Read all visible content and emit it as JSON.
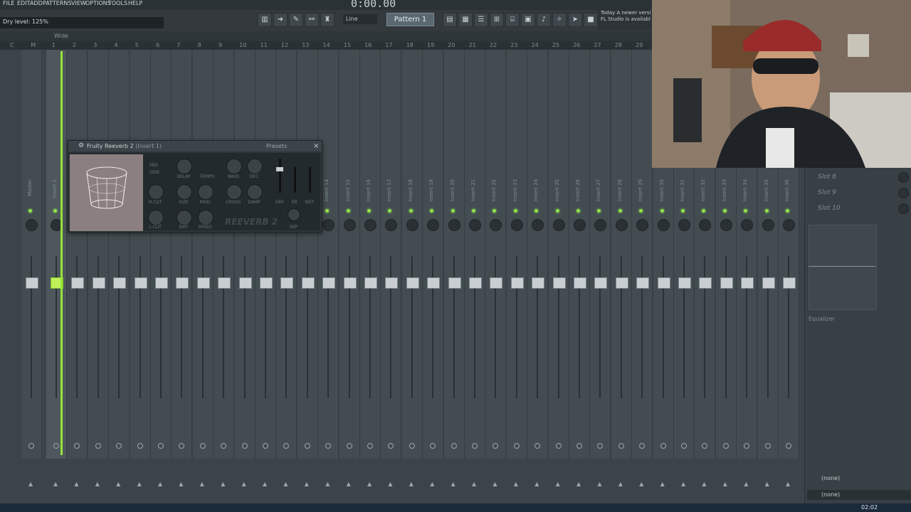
{
  "menu": {
    "items": [
      "FILE",
      "EDIT",
      "ADD",
      "PATTERNS",
      "VIEW",
      "OPTIONS",
      "TOOLS",
      "HELP"
    ],
    "time": "0:00.00"
  },
  "toolbar": {
    "hint": "Dry level: 125%",
    "wide_label": "Wide",
    "line_mode": "Line",
    "pattern": "Pattern 1",
    "news_line1": "Today  A newer versi",
    "news_line2": "FL Studio is availabl"
  },
  "ruler": {
    "ticks": [
      "C",
      "M",
      "1",
      "2",
      "3",
      "4",
      "5",
      "6",
      "7",
      "8",
      "9",
      "10",
      "11",
      "12",
      "13",
      "14",
      "15",
      "16",
      "17",
      "18",
      "19",
      "20",
      "21",
      "22",
      "23",
      "24",
      "25",
      "26",
      "27",
      "28",
      "29"
    ]
  },
  "mixer": {
    "strips": [
      {
        "label": "Master"
      },
      {
        "label": "Insert 1"
      },
      {
        "label": "Insert 2"
      },
      {
        "label": "Insert 3"
      },
      {
        "label": "Insert 4"
      },
      {
        "label": "Insert 5"
      },
      {
        "label": "Insert 6"
      },
      {
        "label": "Insert 7"
      },
      {
        "label": "Insert 8"
      },
      {
        "label": "Insert 9"
      },
      {
        "label": "Insert 10"
      },
      {
        "label": "Insert 11"
      },
      {
        "label": "Insert 12"
      },
      {
        "label": "Insert 13"
      },
      {
        "label": "Insert 14"
      },
      {
        "label": "Insert 15"
      },
      {
        "label": "Insert 16"
      },
      {
        "label": "Insert 17"
      },
      {
        "label": "Insert 18"
      },
      {
        "label": "Insert 19"
      },
      {
        "label": "Insert 20"
      },
      {
        "label": "Insert 21"
      },
      {
        "label": "Insert 22"
      },
      {
        "label": "Insert 23"
      },
      {
        "label": "Insert 24"
      },
      {
        "label": "Insert 25"
      },
      {
        "label": "Insert 26"
      },
      {
        "label": "Insert 27"
      },
      {
        "label": "Insert 28"
      },
      {
        "label": "Insert 29"
      },
      {
        "label": "Insert 30"
      },
      {
        "label": "Insert 31"
      },
      {
        "label": "Insert 32"
      },
      {
        "label": "Insert 33"
      },
      {
        "label": "Insert 34"
      },
      {
        "label": "Insert 35"
      },
      {
        "label": "Insert 36"
      }
    ],
    "selected_index": 1
  },
  "fx_panel": {
    "slots": [
      "Slot 8",
      "Slot 9",
      "Slot 10"
    ],
    "equalizer_label": "Equalizer",
    "input": "(none)",
    "output": "(none)"
  },
  "plugin": {
    "title": "Fruity Reeverb 2",
    "subtitle": "(Insert 1)",
    "presets_label": "Presets",
    "knobs": [
      "DELAY",
      "TEMPO",
      "BASS",
      "DEC",
      "H.CUT",
      "SIZE",
      "MOD",
      "CROSS",
      "DAMP",
      "L.CUT",
      "DIFF",
      "SPEED"
    ],
    "mid_label": "MID",
    "side_label": "SIDE",
    "dry_label": "DRY",
    "er_label": "ER",
    "wet_label": "WET",
    "sep_label": "SEP",
    "logo": "REEVERB 2"
  },
  "taskbar": {
    "clock": "02:02"
  }
}
